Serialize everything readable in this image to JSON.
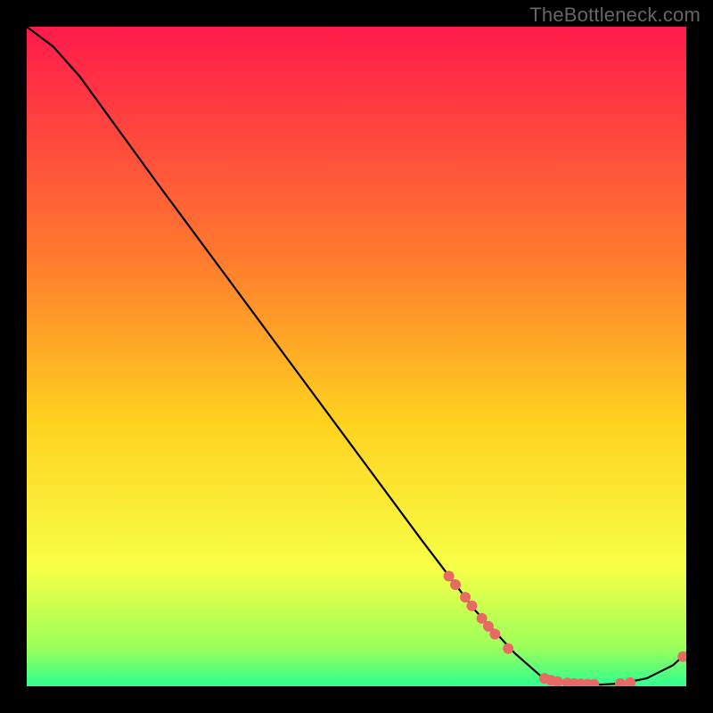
{
  "watermark": "TheBottleneck.com",
  "chart_data": {
    "type": "line",
    "title": "",
    "xlabel": "",
    "ylabel": "",
    "xlim": [
      0,
      100
    ],
    "ylim": [
      0,
      100
    ],
    "background_gradient": {
      "top": "#ff1a4b",
      "mid1": "#ff7a2e",
      "mid2": "#ffd21f",
      "mid3": "#f7ff46",
      "low": "#9dff5a",
      "bottom": "#2eff8f"
    },
    "curve": [
      {
        "x": 0,
        "y": 100
      },
      {
        "x": 4,
        "y": 97
      },
      {
        "x": 8,
        "y": 92.5
      },
      {
        "x": 12,
        "y": 87
      },
      {
        "x": 20,
        "y": 76
      },
      {
        "x": 30,
        "y": 62.5
      },
      {
        "x": 40,
        "y": 49
      },
      {
        "x": 50,
        "y": 35.5
      },
      {
        "x": 60,
        "y": 22
      },
      {
        "x": 68,
        "y": 11.5
      },
      {
        "x": 74,
        "y": 5
      },
      {
        "x": 78,
        "y": 1.5
      },
      {
        "x": 82,
        "y": 0.3
      },
      {
        "x": 86,
        "y": 0.2
      },
      {
        "x": 90,
        "y": 0.4
      },
      {
        "x": 94,
        "y": 1.2
      },
      {
        "x": 98,
        "y": 3.2
      },
      {
        "x": 100,
        "y": 5
      }
    ],
    "markers": [
      {
        "x": 64,
        "y": 16.7
      },
      {
        "x": 65,
        "y": 15.4
      },
      {
        "x": 66.5,
        "y": 13.5
      },
      {
        "x": 67.5,
        "y": 12.2
      },
      {
        "x": 69,
        "y": 10.3
      },
      {
        "x": 70,
        "y": 9.1
      },
      {
        "x": 71,
        "y": 7.9
      },
      {
        "x": 73,
        "y": 5.7
      },
      {
        "x": 78.5,
        "y": 1.2
      },
      {
        "x": 79.5,
        "y": 0.9
      },
      {
        "x": 80.5,
        "y": 0.7
      },
      {
        "x": 82,
        "y": 0.5
      },
      {
        "x": 83,
        "y": 0.4
      },
      {
        "x": 84,
        "y": 0.35
      },
      {
        "x": 85,
        "y": 0.3
      },
      {
        "x": 86,
        "y": 0.3
      },
      {
        "x": 90,
        "y": 0.4
      },
      {
        "x": 91.5,
        "y": 0.55
      },
      {
        "x": 99.5,
        "y": 4.5
      }
    ],
    "marker_color": "#e86a65",
    "line_color": "#000000"
  }
}
